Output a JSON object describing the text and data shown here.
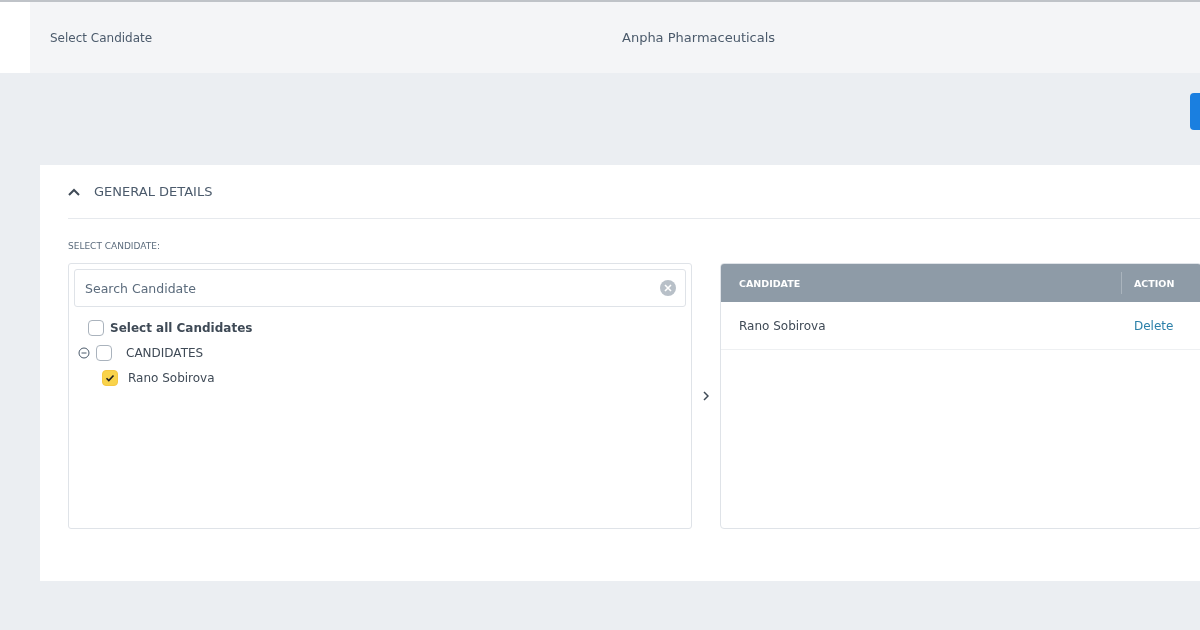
{
  "header": {
    "title": "Select Candidate",
    "company": "Anpha Pharmaceuticals"
  },
  "section": {
    "title": "GENERAL DETAILS",
    "expanded": true
  },
  "field_label": "SELECT CANDIDATE:",
  "search": {
    "placeholder": "Search Candidate"
  },
  "select_all": {
    "label": "Select all Candidates",
    "checked": false
  },
  "tree": [
    {
      "label": "CANDIDATES",
      "checked": false,
      "expanded": true,
      "children": [
        {
          "label": "Rano Sobirova",
          "checked": true
        }
      ]
    }
  ],
  "table": {
    "columns": [
      "CANDIDATE",
      "ACTION"
    ],
    "rows": [
      {
        "candidate": "Rano Sobirova",
        "action": "Delete"
      }
    ]
  }
}
